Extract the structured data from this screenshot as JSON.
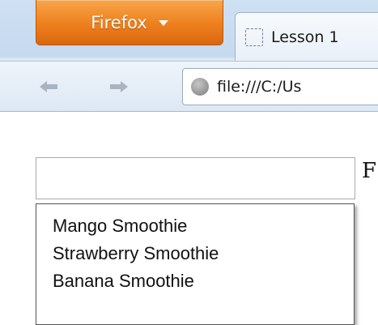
{
  "browser": {
    "menu_button_label": "Firefox",
    "tab_title": "Lesson 1",
    "url": "file:///C:/Us"
  },
  "page": {
    "input_value": "",
    "trailing_text": "F",
    "suggestions": [
      {
        "label": "Mango Smoothie"
      },
      {
        "label": "Strawberry Smoothie"
      },
      {
        "label": "Banana Smoothie"
      }
    ]
  }
}
